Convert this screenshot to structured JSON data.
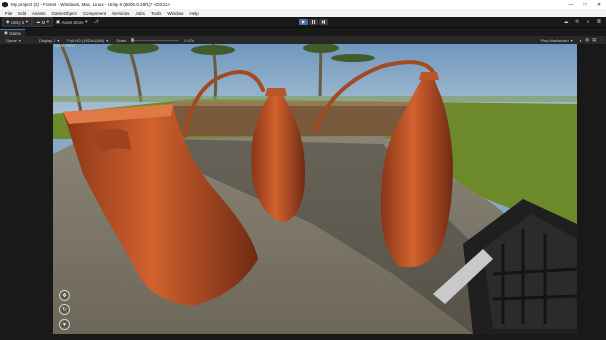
{
  "window": {
    "title": "My project (2) - Forest - Windows, Mac, Linux - Unity 6 (6000.0.29f1)* <DX11>",
    "controls": [
      "—",
      "□",
      "✕"
    ]
  },
  "menubar": {
    "items": [
      "File",
      "Edit",
      "Assets",
      "GameObject",
      "Component",
      "Services",
      "Jobs",
      "Tools",
      "Window",
      "Help"
    ]
  },
  "toolbar": {
    "account_label": "Unity 6",
    "account_short": "M",
    "store_label": "Asset Store",
    "play_state": "playing"
  },
  "tabs": [
    {
      "label": "Game",
      "icon": "gamepad-icon"
    }
  ],
  "gamebar": {
    "mode": "Game",
    "display": "Display 1",
    "resolution": "Full HD (1920x1080)",
    "scale_label": "Scale",
    "scale_value": "0.47x",
    "play_mode": "Play Maximized",
    "stats_overlay": "GAME VIEW"
  },
  "viewport_controls": [
    {
      "name": "camera-move-icon",
      "glyph": "✥"
    },
    {
      "name": "camera-rotate-icon",
      "glyph": "↻"
    },
    {
      "name": "heart-icon",
      "glyph": "♥"
    }
  ],
  "colors": {
    "accent": "#3a79bb",
    "copper": "#c0532a",
    "sky": "#87a9c6",
    "grass": "#6d8a2a"
  }
}
